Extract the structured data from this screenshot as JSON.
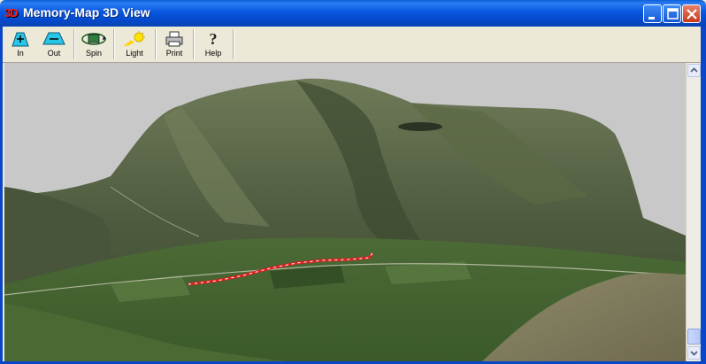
{
  "window": {
    "title": "Memory-Map 3D View",
    "app_icon_text": "3D",
    "controls": [
      "minimize-icon",
      "maximize-icon",
      "close-icon"
    ]
  },
  "toolbar": {
    "tools": [
      {
        "label": "In",
        "icon": "zoom-in-icon"
      },
      {
        "label": "Out",
        "icon": "zoom-out-icon"
      },
      {
        "label": "Spin",
        "icon": "spin-icon"
      },
      {
        "label": "Light",
        "icon": "light-icon"
      },
      {
        "label": "Print",
        "icon": "printer-icon"
      },
      {
        "label": "Help",
        "icon": "help-icon"
      }
    ]
  },
  "view": {
    "content": "3D terrain render of a mountain with a red route line in the valley",
    "route_color": "#e02020"
  },
  "colors": {
    "title_bar": "#0a5fd8",
    "background": "#c8c8c8",
    "terrain_dark": "#3f4f35",
    "terrain_light": "#7f8f66"
  }
}
